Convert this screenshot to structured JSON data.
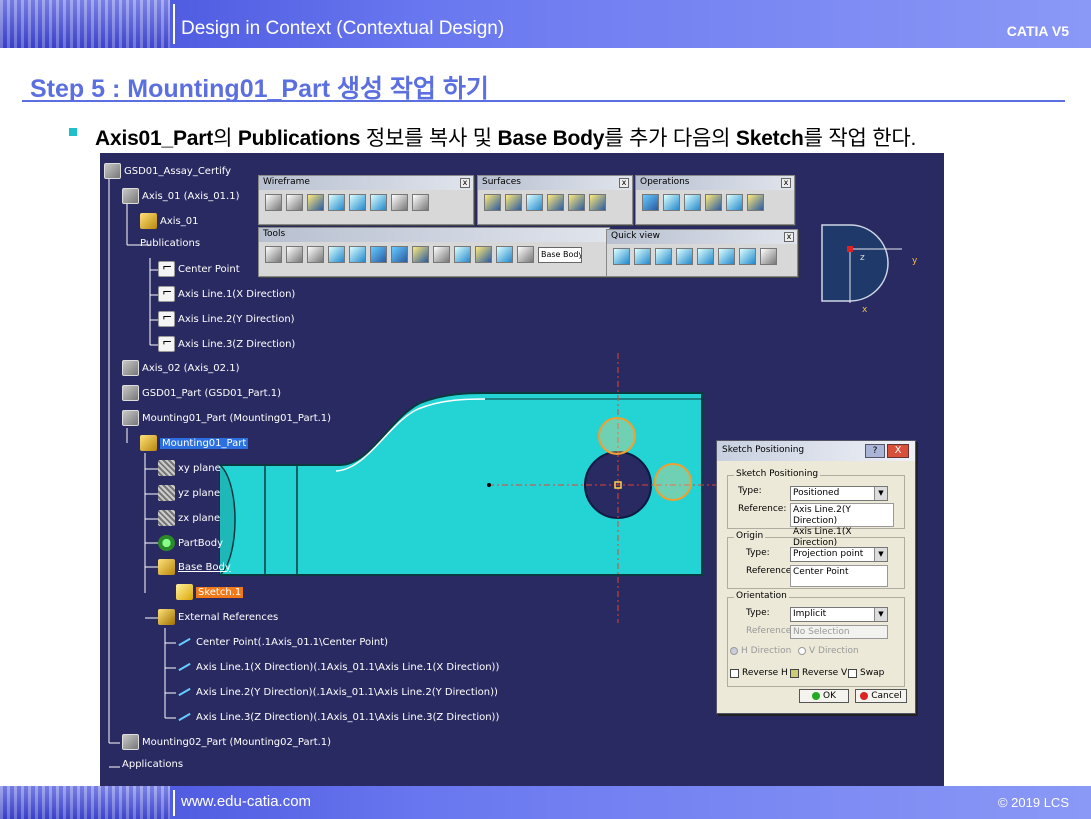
{
  "header": {
    "title": "Design in Context (Contextual Design)",
    "brand": "CATIA V5"
  },
  "step_title": "Step 5 : Mounting01_Part 생성 작업 하기",
  "bullet": {
    "b1": "Axis01_Part",
    "t1": "의 ",
    "b2": "Publications",
    "t2": " 정보를 복사 및 ",
    "b3": "Base Body",
    "t3": "를 추가 다음의 ",
    "b4": "Sketch",
    "t4": "를 작업 한다."
  },
  "tree": {
    "items": [
      "GSD01_Assay_Certify",
      "Axis_01 (Axis_01.1)",
      "Axis_01",
      "Publications",
      "Center Point",
      "Axis Line.1(X Direction)",
      "Axis Line.2(Y Direction)",
      "Axis Line.3(Z Direction)",
      "Axis_02 (Axis_02.1)",
      "GSD01_Part (GSD01_Part.1)",
      "Mounting01_Part (Mounting01_Part.1)",
      "Mounting01_Part",
      "xy plane",
      "yz plane",
      "zx plane",
      "PartBody",
      "Base Body",
      "Sketch.1",
      "External References",
      "Center Point(.1Axis_01.1\\Center Point)",
      "Axis Line.1(X Direction)(.1Axis_01.1\\Axis Line.1(X Direction))",
      "Axis Line.2(Y Direction)(.1Axis_01.1\\Axis Line.2(Y Direction))",
      "Axis Line.3(Z Direction)(.1Axis_01.1\\Axis Line.3(Z Direction))",
      "Mounting02_Part (Mounting02_Part.1)",
      "Applications"
    ]
  },
  "toolbars": {
    "wireframe": "Wireframe",
    "surfaces": "Surfaces",
    "operations": "Operations",
    "tools": "Tools",
    "tools_select": "Base Body",
    "quick_view": "Quick view",
    "close": "x"
  },
  "compass": {
    "z": "z",
    "y": "y",
    "x": "x"
  },
  "dialog": {
    "title": "Sketch Positioning",
    "help": "?",
    "close": "X",
    "group_sketch": "Sketch Positioning",
    "type_label": "Type:",
    "sp_type": "Positioned",
    "reference_label": "Reference:",
    "sp_ref1": "Axis Line.2(Y Direction)",
    "sp_ref2": "Axis Line.1(X Direction)",
    "group_origin": "Origin",
    "origin_type": "Projection point",
    "origin_ref": "Center Point",
    "group_orientation": "Orientation",
    "orient_type": "Implicit",
    "orient_ref": "No Selection",
    "h_direction": "H Direction",
    "v_direction": "V Direction",
    "reverse_h": "Reverse H",
    "reverse_v": "Reverse V",
    "swap": "Swap",
    "ok": "OK",
    "cancel": "Cancel"
  },
  "footer": {
    "url": "www.edu-catia.com",
    "copyright": "© 2019 LCS"
  },
  "colors": {
    "accent": "#5b6fe0",
    "viewport": "#2a2a62",
    "part": "#24d4d4",
    "highlight": "#f0a030"
  }
}
